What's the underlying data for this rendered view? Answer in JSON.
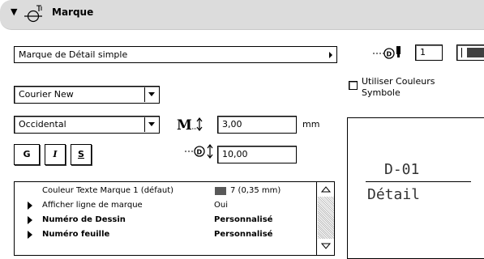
{
  "header": {
    "title": "Marque",
    "toggle_icon": "disclosure-triangle-down",
    "tool_icon": "marker-tool-icon"
  },
  "marker_type": {
    "value": "Marque de Détail simple"
  },
  "font": {
    "value": "Courier New"
  },
  "script": {
    "value": "Occidental"
  },
  "text_height": {
    "value": "3,00",
    "unit": "mm"
  },
  "style_buttons": {
    "bold": "G",
    "italic": "I",
    "strike": "S"
  },
  "marker_size": {
    "value": "10,00"
  },
  "pen": {
    "value": "1"
  },
  "use_symbol_colors": {
    "label_line1": "Utiliser Couleurs",
    "label_line2": "Symbole",
    "checked": false
  },
  "preview": {
    "top_text": "D-01",
    "bottom_text": "Détail"
  },
  "properties": {
    "rows": [
      {
        "label": "Couleur Texte Marque 1 (défaut)",
        "value": "7 (0,35 mm)",
        "bold": false,
        "expander": false
      },
      {
        "label": "Afficher ligne de marque",
        "value": "Oui",
        "bold": false,
        "expander": true
      },
      {
        "label": "Numéro de Dessin",
        "value": "Personnalisé",
        "bold": true,
        "expander": true
      },
      {
        "label": "Numéro feuille",
        "value": "Personnalisé",
        "bold": true,
        "expander": true
      }
    ],
    "swatch_color": "#595959"
  },
  "colors": {
    "header_bg": "#dcdcdc",
    "pen_swatch": "#404040"
  }
}
